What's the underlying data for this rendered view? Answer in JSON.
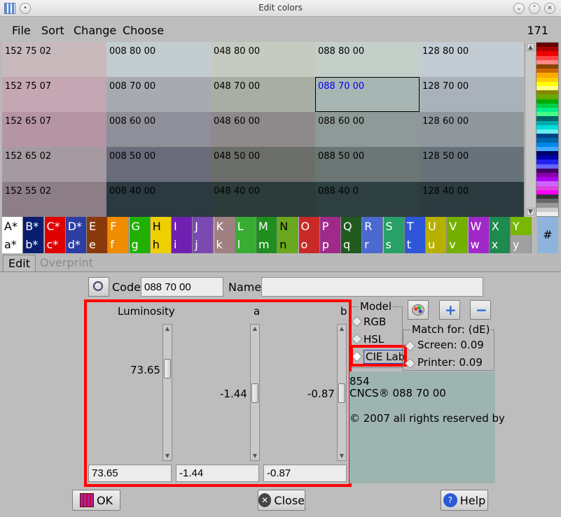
{
  "window": {
    "title": "Edit colors"
  },
  "menu": {
    "items": [
      "File",
      "Sort",
      "Change",
      "Choose"
    ],
    "count": "171"
  },
  "grid": {
    "selected_text_color": "#0000ff",
    "rows": [
      [
        {
          "label": "152 75 02",
          "bg": "#c8b9bd"
        },
        {
          "label": "008 80 00",
          "bg": "#c3cccf"
        },
        {
          "label": "048 80 00",
          "bg": "#c6cbc1"
        },
        {
          "label": "088 80 00",
          "bg": "#c4cfca"
        },
        {
          "label": "128 80 00",
          "bg": "#c3ccd3"
        }
      ],
      [
        {
          "label": "152 75 07",
          "bg": "#c4a7b2"
        },
        {
          "label": "008 70 00",
          "bg": "#a7aab0"
        },
        {
          "label": "048 70 00",
          "bg": "#a8aea4"
        },
        {
          "label": "088 70 00",
          "bg": "#a8b6b3",
          "selected": true
        },
        {
          "label": "128 70 00",
          "bg": "#a9b2ba"
        }
      ],
      [
        {
          "label": "152 65 07",
          "bg": "#b595a3"
        },
        {
          "label": "008 60 00",
          "bg": "#8f8f99"
        },
        {
          "label": "048 60 00",
          "bg": "#8e8a8b"
        },
        {
          "label": "088 60 00",
          "bg": "#8e9a98"
        },
        {
          "label": "128 60 00",
          "bg": "#8f979c"
        }
      ],
      [
        {
          "label": "152 65 02",
          "bg": "#a69aa1"
        },
        {
          "label": "008 50 00",
          "bg": "#6a6b7b"
        },
        {
          "label": "048 50 00",
          "bg": "#6c6e6a"
        },
        {
          "label": "088 50 00",
          "bg": "#6a7574"
        },
        {
          "label": "128 50 00",
          "bg": "#68727a"
        }
      ],
      [
        {
          "label": "152 55 02",
          "bg": "#8c7d86"
        },
        {
          "label": "008 40 00",
          "bg": "#2b3a41"
        },
        {
          "label": "048 40 00",
          "bg": "#2c3c3a"
        },
        {
          "label": "088 40 0",
          "bg": "#2d3f40"
        },
        {
          "label": "128 40 00",
          "bg": "#2b3b40"
        }
      ]
    ]
  },
  "palette": {
    "colors": [
      "#600",
      "#a00",
      "#e00",
      "#f44",
      "#f88",
      "#840",
      "#c60",
      "#fa0",
      "#fc0",
      "#ff0",
      "#ff8",
      "#880",
      "#6a0",
      "#0a0",
      "#0c4",
      "#0e8",
      "#4f8",
      "#066",
      "#0aa",
      "#0dd",
      "#6ee",
      "#048",
      "#06a",
      "#08e",
      "#4af",
      "#006",
      "#00a",
      "#22e",
      "#66f",
      "#406",
      "#80a",
      "#a0e",
      "#c6f",
      "#d4d",
      "#f0f",
      "#333",
      "#666",
      "#999",
      "#ccc",
      "#eee"
    ]
  },
  "letter_rows": [
    {
      "labels": [
        "A*",
        "B*",
        "C*",
        "D*",
        "E",
        "F",
        "G",
        "H",
        "I",
        "J",
        "K",
        "L",
        "M",
        "N",
        "O",
        "P",
        "Q",
        "R",
        "S",
        "T",
        "U",
        "V",
        "W",
        "X",
        "Y"
      ],
      "colors": [
        "#ffffff",
        "#0a1e70",
        "#e00000",
        "#2d3ea2",
        "#8a3a0a",
        "#f08c00",
        "#22b000",
        "#eed000",
        "#7020b0",
        "#7a4ab0",
        "#a08080",
        "#3aac34",
        "#1e8e1e",
        "#6aa820",
        "#c82a28",
        "#a02a8a",
        "#205a1e",
        "#4a6ad0",
        "#28a068",
        "#2e56d8",
        "#b8b000",
        "#74b000",
        "#a028c8",
        "#1e8a4e",
        "#78b800"
      ],
      "text": [
        "#000",
        "#fff",
        "#fff",
        "#fff",
        "#fff",
        "#fff",
        "#fff",
        "#000",
        "#fff",
        "#fff",
        "#fff",
        "#fff",
        "#fff",
        "#000",
        "#fff",
        "#fff",
        "#fff",
        "#fff",
        "#fff",
        "#fff",
        "#fff",
        "#fff",
        "#fff",
        "#fff",
        "#fff"
      ]
    },
    {
      "labels": [
        "a*",
        "b*",
        "c*",
        "d*",
        "e",
        "f",
        "g",
        "h",
        "i",
        "j",
        "k",
        "l",
        "m",
        "n",
        "o",
        "p",
        "q",
        "r",
        "s",
        "t",
        "u",
        "v",
        "w",
        "x",
        "y"
      ],
      "colors": [
        "#ffffff",
        "#0a1e70",
        "#e00000",
        "#2d3ea2",
        "#8a3a0a",
        "#f08c00",
        "#22b000",
        "#eed000",
        "#7020b0",
        "#7a4ab0",
        "#a08080",
        "#3aac34",
        "#1e8e1e",
        "#6aa820",
        "#c82a28",
        "#a02a8a",
        "#205a1e",
        "#4a6ad0",
        "#28a068",
        "#2e56d8",
        "#b8b000",
        "#74b000",
        "#a028c8",
        "#1e8a4e",
        "#a0a0a0"
      ],
      "text": [
        "#000",
        "#fff",
        "#fff",
        "#fff",
        "#fff",
        "#fff",
        "#fff",
        "#000",
        "#fff",
        "#fff",
        "#fff",
        "#fff",
        "#fff",
        "#000",
        "#fff",
        "#fff",
        "#fff",
        "#fff",
        "#fff",
        "#fff",
        "#fff",
        "#fff",
        "#fff",
        "#fff",
        "#fff"
      ]
    }
  ],
  "hash_label": "#",
  "tabs": {
    "edit": "Edit",
    "overprint": "Overprint"
  },
  "code": {
    "label": "Code",
    "value": "088 70 00"
  },
  "name": {
    "label": "Name",
    "value": ""
  },
  "sliders": [
    {
      "label": "Luminosity",
      "value": "73.65",
      "field": "73.65",
      "fraction": 0.26
    },
    {
      "label": "a",
      "value": "-1.44",
      "field": "-1.44",
      "fraction": 0.51
    },
    {
      "label": "b",
      "value": "-0.87",
      "field": "-0.87",
      "fraction": 0.51
    }
  ],
  "model": {
    "title": "Model",
    "options": [
      "RGB",
      "HSL",
      "CIE Lab"
    ],
    "selected": "CIE Lab"
  },
  "match": {
    "title": "Match for: (dE)",
    "screen": "Screen: 0.09",
    "printer": "Printer: 0.09"
  },
  "info": {
    "line1": "854",
    "line2": "CNCS® 088 70 00",
    "line3": "© 2007 all rights reserved by",
    "bg": "#9eb4b1"
  },
  "buttons": {
    "ok": "OK",
    "close": "Close",
    "help": "Help"
  },
  "accent": "#ff0000"
}
